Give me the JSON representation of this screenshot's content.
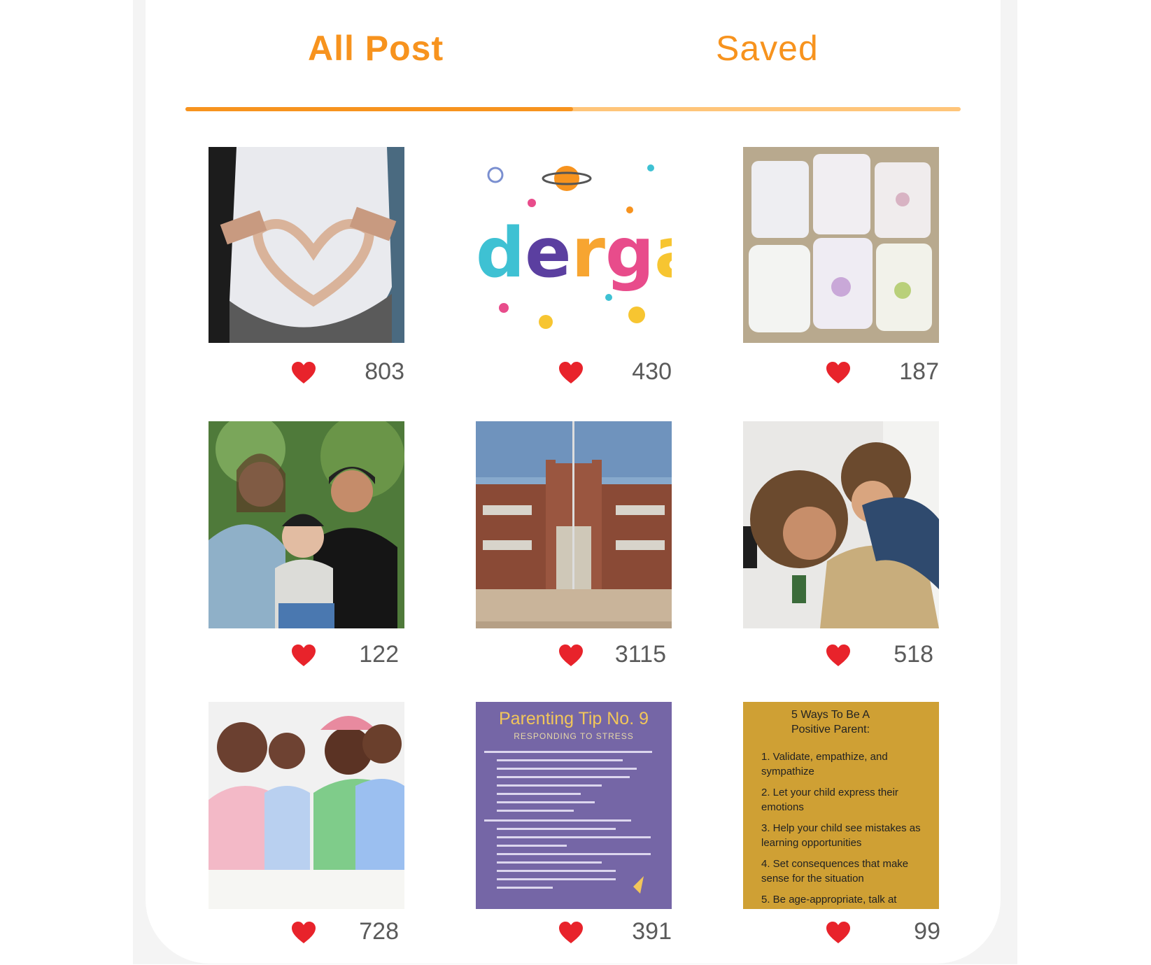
{
  "tabs": {
    "all_post": "All Post",
    "saved": "Saved",
    "active": "All Post"
  },
  "colors": {
    "accent": "#F7931E",
    "accent_light": "#FFC57A",
    "heart": "#E8232B"
  },
  "posts": [
    {
      "image": "pregnant-belly-heart-hands-photo",
      "likes": "803"
    },
    {
      "image": "kindergarten-lettering-illustration",
      "text": "dergar",
      "likes": "430"
    },
    {
      "image": "diapers-on-carpet-photo",
      "likes": "187"
    },
    {
      "image": "two-mothers-with-baby-photo",
      "likes": "122"
    },
    {
      "image": "school-building-photo",
      "likes": "3115"
    },
    {
      "image": "parent-piggyback-child-photo",
      "likes": "518"
    },
    {
      "image": "two-fathers-with-children-photo",
      "likes": "728"
    },
    {
      "image": "parenting-tip-poster",
      "title": "Parenting Tip No. 9",
      "subtitle": "RESPONDING TO STRESS",
      "likes": "391"
    },
    {
      "image": "positive-parent-list-poster",
      "title": "5 Ways To Be A Positive Parent:",
      "items": [
        "1. Validate, empathize, and sympathize",
        "2. Let your child express their emotions",
        "3. Help your child see mistakes as learning opportunities",
        "4. Set consequences that make sense for the situation",
        "5. Be age-appropriate, talk at"
      ],
      "likes": "99"
    }
  ]
}
